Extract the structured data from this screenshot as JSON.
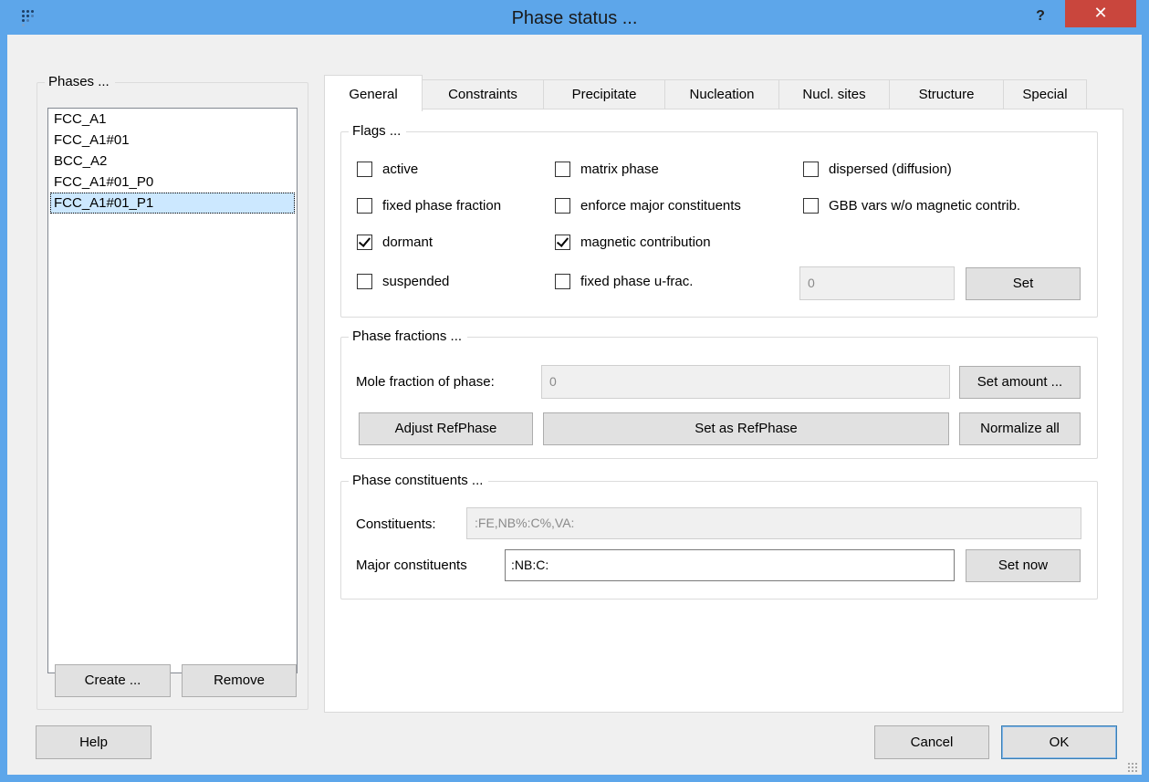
{
  "window": {
    "title": "Phase status ...",
    "help_glyph": "?",
    "close_glyph": "✕"
  },
  "phases": {
    "group_title": "Phases ...",
    "items": [
      "FCC_A1",
      "FCC_A1#01",
      "BCC_A2",
      "FCC_A1#01_P0",
      "FCC_A1#01_P1"
    ],
    "selected_index": 4,
    "create_label": "Create ...",
    "remove_label": "Remove"
  },
  "tabs": [
    {
      "label": "General",
      "active": true
    },
    {
      "label": "Constraints"
    },
    {
      "label": "Precipitate"
    },
    {
      "label": "Nucleation"
    },
    {
      "label": "Nucl. sites"
    },
    {
      "label": "Structure"
    },
    {
      "label": "Special"
    }
  ],
  "flags": {
    "group_title": "Flags ...",
    "active": {
      "label": "active",
      "checked": false
    },
    "matrix_phase": {
      "label": "matrix phase",
      "checked": false
    },
    "dispersed": {
      "label": "dispersed (diffusion)",
      "checked": false
    },
    "fixed_phase_fraction": {
      "label": "fixed phase fraction",
      "checked": false
    },
    "enforce_major": {
      "label": "enforce major constituents",
      "checked": false
    },
    "gbb_vars": {
      "label": "GBB vars w/o magnetic contrib.",
      "checked": false
    },
    "dormant": {
      "label": "dormant",
      "checked": true
    },
    "magnetic": {
      "label": "magnetic contribution",
      "checked": true
    },
    "suspended": {
      "label": "suspended",
      "checked": false
    },
    "fixed_u_frac": {
      "label": "fixed phase u-frac.",
      "checked": false
    },
    "u_frac_value": "0",
    "set_label": "Set"
  },
  "fractions": {
    "group_title": "Phase fractions ...",
    "mole_label": "Mole fraction of phase:",
    "mole_value": "0",
    "set_amount_label": "Set amount ...",
    "adjust_label": "Adjust RefPhase",
    "set_ref_label": "Set as RefPhase",
    "normalize_label": "Normalize all"
  },
  "constituents": {
    "group_title": "Phase constituents ...",
    "constituents_label": "Constituents:",
    "constituents_value": ":FE,NB%:C%,VA:",
    "major_label": "Major constituents",
    "major_value": ":NB:C:",
    "set_now_label": "Set now"
  },
  "footer": {
    "help_label": "Help",
    "cancel_label": "Cancel",
    "ok_label": "OK"
  },
  "colors": {
    "titlebar": "#5da6ea",
    "close": "#c9463d",
    "selection": "#cce8ff"
  },
  "icons": [
    "app-logo-icon",
    "help-icon",
    "close-icon",
    "checkbox-check-icon",
    "resize-grip-icon"
  ]
}
